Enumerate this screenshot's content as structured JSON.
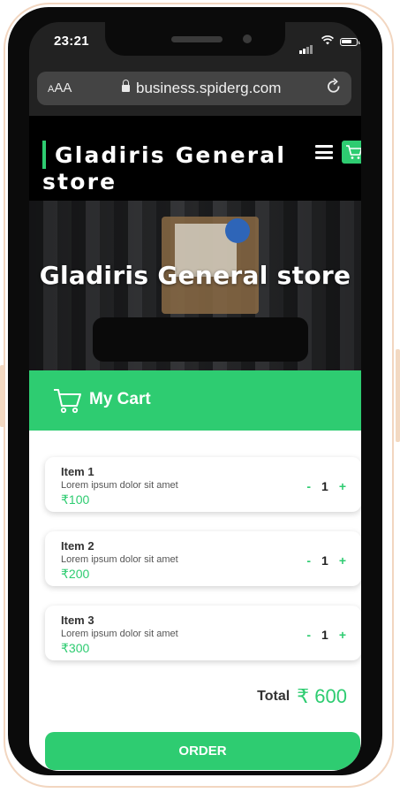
{
  "status_bar": {
    "time": "23:21"
  },
  "browser": {
    "text_size_label": "AA",
    "url": "business.spiderg.com"
  },
  "header": {
    "brand_line1": "Gladiris General",
    "brand_line2": "store"
  },
  "hero": {
    "title": "Gladiris General store"
  },
  "cart": {
    "title": "My Cart",
    "items": [
      {
        "name": "Item 1",
        "description": "Lorem ipsum dolor sit amet",
        "price": "₹100",
        "qty": "1",
        "minus": "-",
        "plus": "+"
      },
      {
        "name": "Item 2",
        "description": "Lorem ipsum dolor sit amet",
        "price": "₹200",
        "qty": "1",
        "minus": "-",
        "plus": "+"
      },
      {
        "name": "Item 3",
        "description": "Lorem ipsum dolor sit amet",
        "price": "₹300",
        "qty": "1",
        "minus": "-",
        "plus": "+"
      }
    ],
    "total_label": "Total",
    "total_value": "₹ 600",
    "order_label": "ORDER"
  },
  "colors": {
    "accent": "#2ecc71",
    "frame": "#f2d6c0",
    "text_dark": "#333333"
  },
  "icons": [
    "lock-icon",
    "reload-icon",
    "hamburger-menu-icon",
    "cart-icon",
    "signal-icon",
    "wifi-icon",
    "battery-icon"
  ]
}
